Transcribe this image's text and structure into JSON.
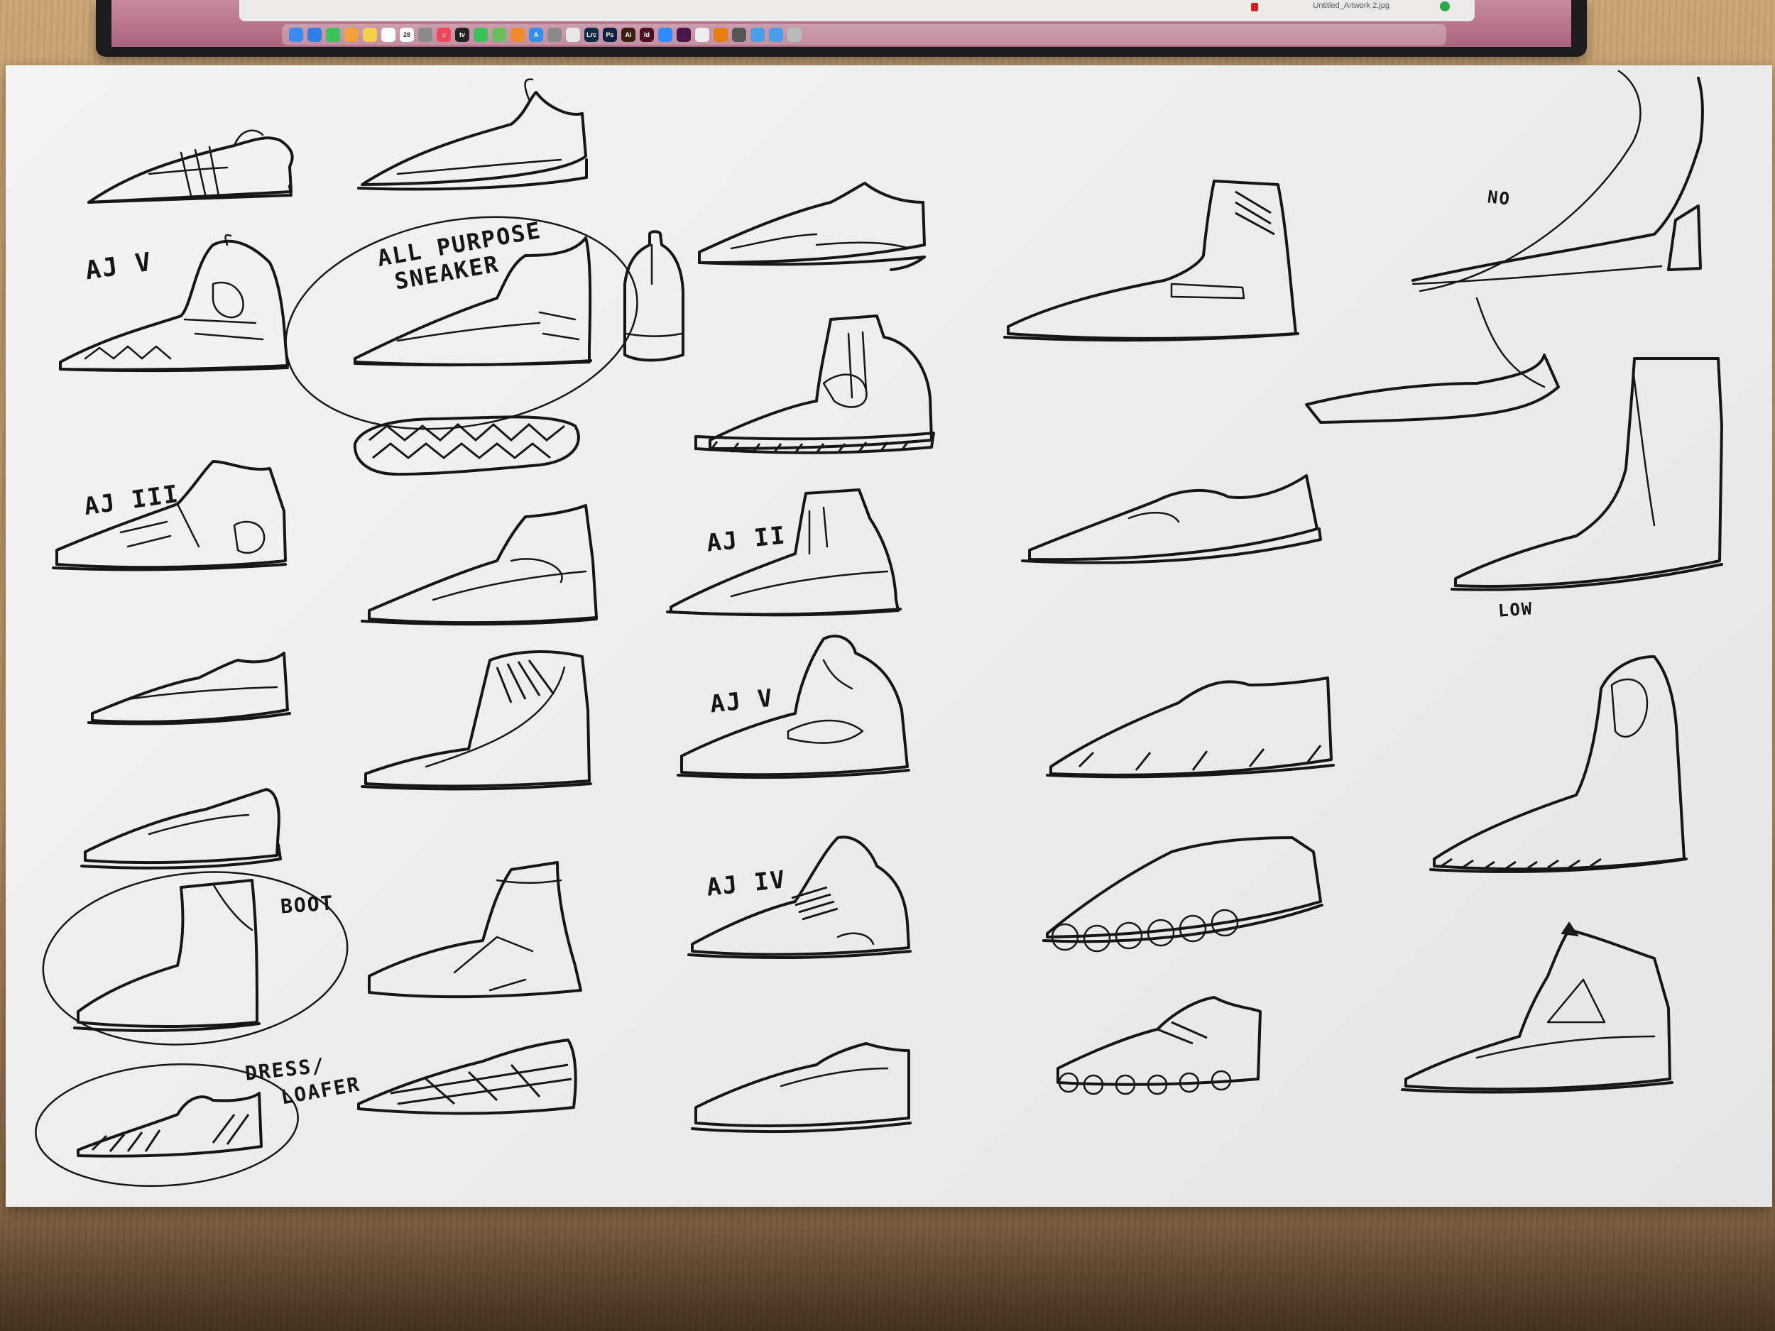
{
  "scene": {
    "type": "photo",
    "paper_color": "#eeeeee",
    "ink_color": "#161616",
    "desk_color": "#b88f60"
  },
  "laptop_screen": {
    "file_name": "Untitled_Artwork 2.jpg",
    "dock_icons": [
      {
        "name": "finder-icon",
        "glyph": "",
        "color": "#3a8df0"
      },
      {
        "name": "safari-icon",
        "glyph": "",
        "color": "#2f7ee6"
      },
      {
        "name": "messages-icon",
        "glyph": "",
        "color": "#3cc25a"
      },
      {
        "name": "photos-icon",
        "glyph": "",
        "color": "#f0a23c"
      },
      {
        "name": "notes-icon",
        "glyph": "",
        "color": "#f2d04c"
      },
      {
        "name": "reminders-icon",
        "glyph": "",
        "color": "#ffffff"
      },
      {
        "name": "calendar-icon",
        "glyph": "28",
        "color": "#ffffff"
      },
      {
        "name": "launchpad-icon",
        "glyph": "",
        "color": "#8a8a8a"
      },
      {
        "name": "music-icon",
        "glyph": "♫",
        "color": "#f0455a"
      },
      {
        "name": "tv-icon",
        "glyph": "tv",
        "color": "#222222"
      },
      {
        "name": "facetime-icon",
        "glyph": "",
        "color": "#3cc25a"
      },
      {
        "name": "maps-icon",
        "glyph": "",
        "color": "#6bbf5a"
      },
      {
        "name": "books-icon",
        "glyph": "",
        "color": "#f08a2c"
      },
      {
        "name": "appstore-icon",
        "glyph": "A",
        "color": "#2f8ef0"
      },
      {
        "name": "settings-icon",
        "glyph": "",
        "color": "#8a8a8a"
      },
      {
        "name": "chrome-icon",
        "glyph": "",
        "color": "#e8e8e8"
      },
      {
        "name": "lightroom-classic-icon",
        "glyph": "Lrc",
        "color": "#0b2a44"
      },
      {
        "name": "photoshop-icon",
        "glyph": "Ps",
        "color": "#0b2244"
      },
      {
        "name": "illustrator-icon",
        "glyph": "Ai",
        "color": "#3a1f0a"
      },
      {
        "name": "indesign-icon",
        "glyph": "Id",
        "color": "#4a0f22"
      },
      {
        "name": "zoom-icon",
        "glyph": "",
        "color": "#2d8cff"
      },
      {
        "name": "slack-icon",
        "glyph": "",
        "color": "#4a154b"
      },
      {
        "name": "app-icon",
        "glyph": "",
        "color": "#eeeeee"
      },
      {
        "name": "blender-icon",
        "glyph": "",
        "color": "#e87d0d"
      },
      {
        "name": "grayscale-app-icon",
        "glyph": "",
        "color": "#555555"
      },
      {
        "name": "folder-icon",
        "glyph": "",
        "color": "#4aa0e8"
      },
      {
        "name": "downloads-icon",
        "glyph": "",
        "color": "#4aa0e8"
      },
      {
        "name": "trash-icon",
        "glyph": "",
        "color": "#bbbbbb"
      }
    ]
  },
  "sketch_labels": {
    "ajv_top": "AJ V",
    "all_purpose_line1": "ALL PURPOSE",
    "all_purpose_line2": "SNEAKER",
    "ajiii": "AJ III",
    "aji_ii": "AJ II",
    "ajv_mid": "AJ V",
    "ajiv": "AJ IV",
    "boot": "BOOT",
    "dress_line1": "DRESS/",
    "dress_line2": "LOAFER",
    "no": "NO",
    "low": "LOW"
  }
}
